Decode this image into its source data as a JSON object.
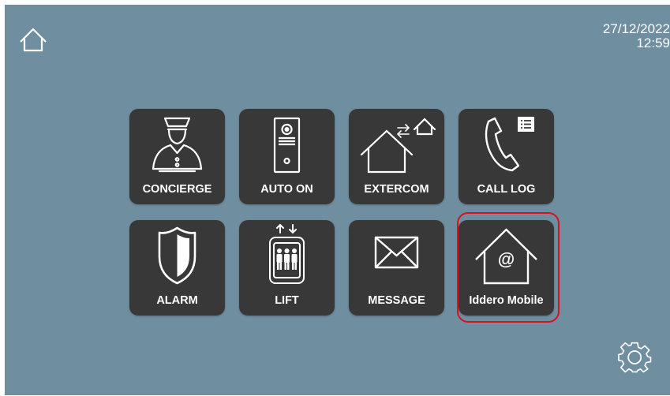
{
  "header": {
    "date": "27/12/2022",
    "time": "12:59",
    "home_icon": "home-icon"
  },
  "menu": {
    "tiles": [
      {
        "label": "CONCIERGE",
        "icon": "concierge-icon"
      },
      {
        "label": "AUTO ON",
        "icon": "auto-on-icon"
      },
      {
        "label": "EXTERCOM",
        "icon": "extercom-icon"
      },
      {
        "label": "CALL LOG",
        "icon": "call-log-icon"
      },
      {
        "label": "ALARM",
        "icon": "alarm-shield-icon"
      },
      {
        "label": "LIFT",
        "icon": "lift-icon"
      },
      {
        "label": "MESSAGE",
        "icon": "envelope-icon"
      },
      {
        "label": "Iddero Mobile",
        "icon": "iddero-mobile-icon"
      }
    ],
    "highlighted": "Iddero Mobile",
    "highlight_color": "#d8111d"
  },
  "footer": {
    "settings_icon": "gear-icon"
  },
  "colors": {
    "background": "#6f8ea0",
    "tile": "#383838",
    "text": "#ffffff"
  }
}
